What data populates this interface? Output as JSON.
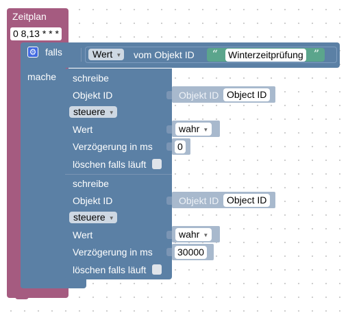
{
  "schedule": {
    "title": "Zeitplan",
    "cron": "0 8,13 * * *"
  },
  "if_block": {
    "falls": "falls",
    "mache": "mache",
    "value_dropdown": "Wert",
    "from_object_label": "vom Objekt ID",
    "string_value": "Winterzeitprüfung"
  },
  "write_blocks": [
    {
      "title": "schreibe",
      "object_id_label": "Objekt ID",
      "object_id_placeholder": "Objekt ID",
      "object_id_value": "Object ID",
      "mode": "steuere",
      "value_label": "Wert",
      "value": "wahr",
      "delay_label": "Verzögerung in ms",
      "delay": "0",
      "clear_label": "löschen falls läuft"
    },
    {
      "title": "schreibe",
      "object_id_label": "Objekt ID",
      "object_id_placeholder": "Objekt ID",
      "object_id_value": "Object ID",
      "mode": "steuere",
      "value_label": "Wert",
      "value": "wahr",
      "delay_label": "Verzögerung in ms",
      "delay": "30000",
      "clear_label": "löschen falls läuft"
    }
  ],
  "colors": {
    "schedule_block": "#a55b80",
    "logic_block": "#5b80a5",
    "value_block": "#5ba58c",
    "input_shadow": "#a8b9cd"
  }
}
